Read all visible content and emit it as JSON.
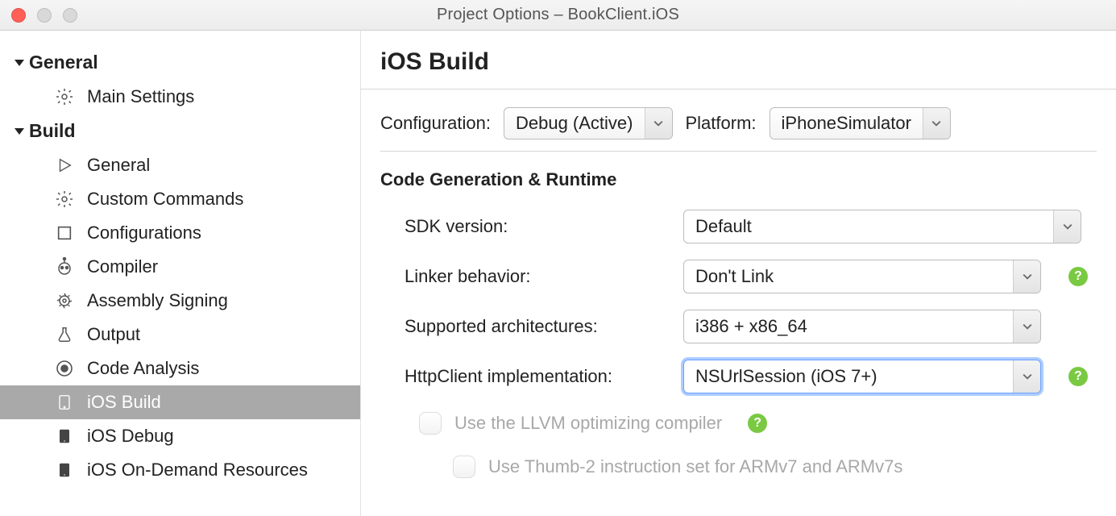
{
  "window": {
    "title": "Project Options – BookClient.iOS"
  },
  "sidebar": {
    "sections": [
      {
        "label": "General",
        "items": [
          {
            "label": "Main Settings",
            "icon": "gear-icon"
          }
        ]
      },
      {
        "label": "Build",
        "items": [
          {
            "label": "General",
            "icon": "play-icon"
          },
          {
            "label": "Custom Commands",
            "icon": "gear-icon"
          },
          {
            "label": "Configurations",
            "icon": "square-icon"
          },
          {
            "label": "Compiler",
            "icon": "robot-icon"
          },
          {
            "label": "Assembly Signing",
            "icon": "badge-icon"
          },
          {
            "label": "Output",
            "icon": "flask-icon"
          },
          {
            "label": "Code Analysis",
            "icon": "target-icon"
          },
          {
            "label": "iOS Build",
            "icon": "phone-icon",
            "selected": true
          },
          {
            "label": "iOS Debug",
            "icon": "phone-dark-icon"
          },
          {
            "label": "iOS On-Demand Resources",
            "icon": "phone-dark-icon"
          }
        ]
      }
    ]
  },
  "main": {
    "title": "iOS Build",
    "config_label": "Configuration:",
    "config_value": "Debug (Active)",
    "platform_label": "Platform:",
    "platform_value": "iPhoneSimulator",
    "section_title": "Code Generation & Runtime",
    "fields": {
      "sdk": {
        "label": "SDK version:",
        "value": "Default"
      },
      "linker": {
        "label": "Linker behavior:",
        "value": "Don't Link"
      },
      "arch": {
        "label": "Supported architectures:",
        "value": "i386 + x86_64"
      },
      "httpclient": {
        "label": "HttpClient implementation:",
        "value": "NSUrlSession (iOS 7+)"
      }
    },
    "checks": {
      "llvm": {
        "label": "Use the LLVM optimizing compiler"
      },
      "thumb": {
        "label": "Use Thumb-2 instruction set for ARMv7 and ARMv7s"
      }
    }
  }
}
